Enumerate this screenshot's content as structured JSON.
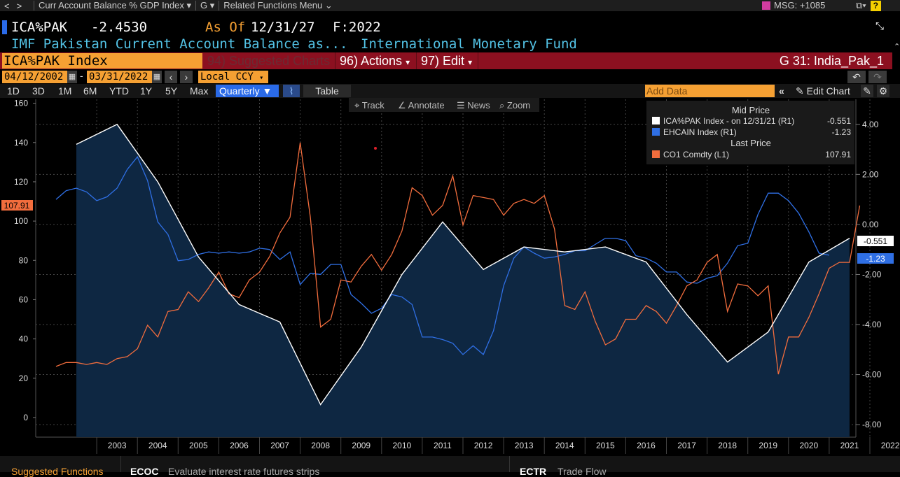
{
  "topbar": {
    "menu1": "Curr Account Balance % GDP Index",
    "menu2": "G",
    "menu3": "Related Functions Menu",
    "msg": "MSG: +1085",
    "help": "?"
  },
  "header": {
    "ticker": "ICA%PAK",
    "value": "-2.4530",
    "as_of_label": "As Of",
    "as_of_date": "12/31/27",
    "f_label": "F:2022",
    "description": "IMF Pakistan Current Account Balance as...",
    "source": "International Monetary Fund"
  },
  "toolbar": {
    "security": "ICA%PAK Index",
    "suggested": "94) Suggested Charts",
    "actions": "96) Actions",
    "edit": "97) Edit",
    "chart_name": "G 31: India_Pak_1"
  },
  "dates": {
    "start": "04/12/2002",
    "end": "03/31/2022",
    "currency": "Local CCY"
  },
  "ranges": {
    "items": [
      "1D",
      "3D",
      "1M",
      "6M",
      "YTD",
      "1Y",
      "5Y",
      "Max"
    ],
    "period": "Quarterly",
    "table": "Table",
    "add_data": "Add Data",
    "edit_chart": "Edit Chart"
  },
  "chart_tools": {
    "track": "Track",
    "annotate": "Annotate",
    "news": "News",
    "zoom": "Zoom"
  },
  "legend": {
    "mid_price_header": "Mid Price",
    "last_price_header": "Last Price",
    "entries": [
      {
        "label": "ICA%PAK Index -  on 12/31/21  (R1)",
        "value": "-0.551"
      },
      {
        "label": "EHCAIN Index  (R1)",
        "value": "-1.23"
      },
      {
        "label": "CO1 Comdty  (L1)",
        "value": "107.91"
      }
    ]
  },
  "chart_data": {
    "type": "line",
    "x_labels": [
      "2003",
      "2004",
      "2005",
      "2006",
      "2007",
      "2008",
      "2009",
      "2010",
      "2011",
      "2012",
      "2013",
      "2014",
      "2015",
      "2016",
      "2017",
      "2018",
      "2019",
      "2020",
      "2021",
      "2022"
    ],
    "left_axis": {
      "ticks": [
        "160",
        "140",
        "120",
        "100",
        "80",
        "60",
        "40",
        "20",
        "0"
      ],
      "min": -10,
      "max": 162
    },
    "right_axis": {
      "ticks": [
        "4.00",
        "2.00",
        "0.00",
        "-2.00",
        "-4.00",
        "-6.00",
        "-8.00"
      ],
      "min": -8.5,
      "max": 5.0
    },
    "last_value_labels": {
      "left": "107.91",
      "right1": "-0.551",
      "right2": "-1.23"
    },
    "colors": {
      "ica": "#ffffff",
      "ehcain": "#2f6fe4",
      "co1": "#f26d3d",
      "area": "#0e2742"
    },
    "series": [
      {
        "name": "ICA%PAK Index",
        "axis": "right",
        "points": [
          [
            2002.5,
            3.2
          ],
          [
            2003.5,
            4.0
          ],
          [
            2004.5,
            1.7
          ],
          [
            2005.5,
            -1.3
          ],
          [
            2006.5,
            -3.2
          ],
          [
            2007.5,
            -3.9
          ],
          [
            2008.5,
            -7.2
          ],
          [
            2009.5,
            -4.9
          ],
          [
            2010.5,
            -2.0
          ],
          [
            2011.5,
            0.1
          ],
          [
            2012.5,
            -1.8
          ],
          [
            2013.5,
            -0.9
          ],
          [
            2014.5,
            -1.1
          ],
          [
            2015.5,
            -0.9
          ],
          [
            2016.5,
            -1.5
          ],
          [
            2017.5,
            -3.6
          ],
          [
            2018.5,
            -5.5
          ],
          [
            2019.5,
            -4.3
          ],
          [
            2020.5,
            -1.5
          ],
          [
            2021.5,
            -0.551
          ]
        ]
      },
      {
        "name": "EHCAIN Index",
        "axis": "right",
        "points": [
          [
            2002.0,
            1.0
          ],
          [
            2002.25,
            1.35
          ],
          [
            2002.5,
            1.45
          ],
          [
            2002.75,
            1.3
          ],
          [
            2003.0,
            0.95
          ],
          [
            2003.25,
            1.1
          ],
          [
            2003.5,
            1.45
          ],
          [
            2003.75,
            2.2
          ],
          [
            2004.0,
            2.7
          ],
          [
            2004.25,
            1.75
          ],
          [
            2004.5,
            0.1
          ],
          [
            2004.75,
            -0.4
          ],
          [
            2005.0,
            -1.45
          ],
          [
            2005.25,
            -1.4
          ],
          [
            2005.5,
            -1.2
          ],
          [
            2005.75,
            -1.1
          ],
          [
            2006.0,
            -1.15
          ],
          [
            2006.25,
            -1.1
          ],
          [
            2006.5,
            -1.15
          ],
          [
            2006.75,
            -1.1
          ],
          [
            2007.0,
            -0.95
          ],
          [
            2007.25,
            -1.0
          ],
          [
            2007.5,
            -1.4
          ],
          [
            2007.75,
            -1.1
          ],
          [
            2008.0,
            -2.4
          ],
          [
            2008.25,
            -1.95
          ],
          [
            2008.5,
            -2.0
          ],
          [
            2008.75,
            -1.6
          ],
          [
            2009.0,
            -1.6
          ],
          [
            2009.25,
            -2.8
          ],
          [
            2009.5,
            -3.15
          ],
          [
            2009.75,
            -3.55
          ],
          [
            2010.0,
            -3.35
          ],
          [
            2010.25,
            -2.8
          ],
          [
            2010.5,
            -2.9
          ],
          [
            2010.75,
            -3.2
          ],
          [
            2011.0,
            -4.5
          ],
          [
            2011.25,
            -4.5
          ],
          [
            2011.5,
            -4.6
          ],
          [
            2011.75,
            -4.75
          ],
          [
            2012.0,
            -5.2
          ],
          [
            2012.25,
            -4.85
          ],
          [
            2012.5,
            -5.2
          ],
          [
            2012.75,
            -4.25
          ],
          [
            2013.0,
            -2.45
          ],
          [
            2013.25,
            -1.35
          ],
          [
            2013.5,
            -0.9
          ],
          [
            2013.75,
            -1.15
          ],
          [
            2014.0,
            -1.35
          ],
          [
            2014.25,
            -1.3
          ],
          [
            2014.5,
            -1.2
          ],
          [
            2014.75,
            -1.05
          ],
          [
            2015.0,
            -1.05
          ],
          [
            2015.25,
            -0.8
          ],
          [
            2015.5,
            -0.55
          ],
          [
            2015.75,
            -0.55
          ],
          [
            2016.0,
            -0.65
          ],
          [
            2016.25,
            -1.25
          ],
          [
            2016.5,
            -1.35
          ],
          [
            2016.75,
            -1.55
          ],
          [
            2017.0,
            -1.9
          ],
          [
            2017.25,
            -1.9
          ],
          [
            2017.5,
            -2.3
          ],
          [
            2017.75,
            -2.35
          ],
          [
            2018.0,
            -2.15
          ],
          [
            2018.25,
            -2.05
          ],
          [
            2018.5,
            -1.55
          ],
          [
            2018.75,
            -0.85
          ],
          [
            2019.0,
            -0.75
          ],
          [
            2019.25,
            0.4
          ],
          [
            2019.5,
            1.25
          ],
          [
            2019.75,
            1.25
          ],
          [
            2020.0,
            0.95
          ],
          [
            2020.25,
            0.45
          ],
          [
            2020.5,
            -0.3
          ],
          [
            2020.75,
            -1.15
          ],
          [
            2021.0,
            -1.23
          ]
        ]
      },
      {
        "name": "CO1 Comdty",
        "axis": "left",
        "points": [
          [
            2002.0,
            26
          ],
          [
            2002.25,
            28
          ],
          [
            2002.5,
            28
          ],
          [
            2002.75,
            27
          ],
          [
            2003.0,
            28
          ],
          [
            2003.25,
            27
          ],
          [
            2003.5,
            30
          ],
          [
            2003.75,
            31
          ],
          [
            2004.0,
            35
          ],
          [
            2004.25,
            47
          ],
          [
            2004.5,
            41
          ],
          [
            2004.75,
            54
          ],
          [
            2005.0,
            55
          ],
          [
            2005.25,
            64
          ],
          [
            2005.5,
            59
          ],
          [
            2005.75,
            66
          ],
          [
            2006.0,
            74
          ],
          [
            2006.25,
            63
          ],
          [
            2006.5,
            61
          ],
          [
            2006.75,
            70
          ],
          [
            2007.0,
            74
          ],
          [
            2007.25,
            82
          ],
          [
            2007.5,
            94
          ],
          [
            2007.75,
            102
          ],
          [
            2008.0,
            140
          ],
          [
            2008.25,
            102
          ],
          [
            2008.5,
            46
          ],
          [
            2008.75,
            50
          ],
          [
            2009.0,
            70
          ],
          [
            2009.25,
            69
          ],
          [
            2009.5,
            77
          ],
          [
            2009.75,
            83
          ],
          [
            2010.0,
            75
          ],
          [
            2010.25,
            83
          ],
          [
            2010.5,
            95
          ],
          [
            2010.75,
            117
          ],
          [
            2011.0,
            113
          ],
          [
            2011.25,
            103
          ],
          [
            2011.5,
            108
          ],
          [
            2011.75,
            123
          ],
          [
            2012.0,
            98
          ],
          [
            2012.25,
            113
          ],
          [
            2012.5,
            112
          ],
          [
            2012.75,
            111
          ],
          [
            2013.0,
            103
          ],
          [
            2013.25,
            109
          ],
          [
            2013.5,
            111
          ],
          [
            2013.75,
            109
          ],
          [
            2014.0,
            113
          ],
          [
            2014.25,
            96
          ],
          [
            2014.5,
            57
          ],
          [
            2014.75,
            55
          ],
          [
            2015.0,
            64
          ],
          [
            2015.25,
            49
          ],
          [
            2015.5,
            37
          ],
          [
            2015.75,
            40
          ],
          [
            2016.0,
            50
          ],
          [
            2016.25,
            50
          ],
          [
            2016.5,
            57
          ],
          [
            2016.75,
            54
          ],
          [
            2017.0,
            48
          ],
          [
            2017.25,
            57
          ],
          [
            2017.5,
            67
          ],
          [
            2017.75,
            70
          ],
          [
            2018.0,
            79
          ],
          [
            2018.25,
            83
          ],
          [
            2018.5,
            54
          ],
          [
            2018.75,
            68
          ],
          [
            2019.0,
            67
          ],
          [
            2019.25,
            62
          ],
          [
            2019.5,
            67
          ],
          [
            2019.75,
            22
          ],
          [
            2020.0,
            41
          ],
          [
            2020.25,
            41
          ],
          [
            2020.5,
            51
          ],
          [
            2020.75,
            63
          ],
          [
            2021.0,
            76
          ],
          [
            2021.25,
            79
          ],
          [
            2021.5,
            79
          ],
          [
            2021.75,
            107.91
          ]
        ]
      }
    ]
  }
}
